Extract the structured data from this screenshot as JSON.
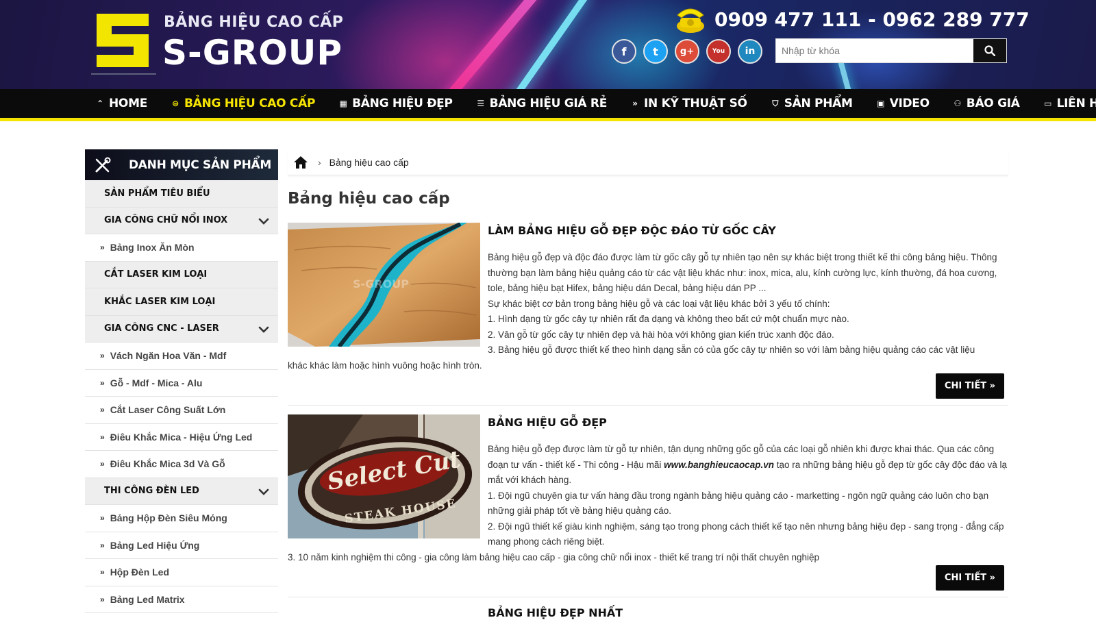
{
  "header": {
    "tagline": "BẢNG HIỆU CAO CẤP",
    "brand": "S-GROUP",
    "phone": "0909 477 111 - 0962 289 777",
    "socials": [
      {
        "name": "facebook",
        "glyph": "f"
      },
      {
        "name": "twitter",
        "glyph": "t"
      },
      {
        "name": "google-plus",
        "glyph": "g+"
      },
      {
        "name": "youtube",
        "glyph": "You"
      },
      {
        "name": "linkedin",
        "glyph": "in"
      }
    ],
    "search": {
      "placeholder": "Nhập từ khóa",
      "value": ""
    }
  },
  "nav": {
    "items": [
      {
        "label": "HOME",
        "icon": "chevron-up"
      },
      {
        "label": "BẢNG HIỆU CAO CẤP",
        "icon": "bars-circle",
        "active": true
      },
      {
        "label": "BẢNG HIỆU ĐẸP",
        "icon": "calendar"
      },
      {
        "label": "BẢNG HIỆU GIÁ RẺ",
        "icon": "list"
      },
      {
        "label": "IN KỸ THUẬT SỐ",
        "icon": "double-chevron-right"
      },
      {
        "label": "SẢN PHẨM",
        "icon": "shield"
      },
      {
        "label": "VIDEO",
        "icon": "youtube"
      },
      {
        "label": "BÁO GIÁ",
        "icon": "users"
      },
      {
        "label": "LIÊN HỆ",
        "icon": "money"
      }
    ]
  },
  "sidebar": {
    "title": "DANH MỤC SẢN PHẨM",
    "items": [
      {
        "label": "SẢN PHẨM TIÊU BIỂU",
        "type": "cat"
      },
      {
        "label": "GIA CÔNG CHỮ NỔI INOX",
        "type": "cat",
        "expandable": true
      },
      {
        "label": "Bảng Inox Ăn Mòn",
        "type": "sub"
      },
      {
        "label": "CẮT LASER KIM LOẠI",
        "type": "cat"
      },
      {
        "label": "KHẮC LASER KIM LOẠI",
        "type": "cat"
      },
      {
        "label": "GIA CÔNG CNC - LASER",
        "type": "cat",
        "expandable": true
      },
      {
        "label": "Vách Ngăn Hoa Văn - Mdf",
        "type": "sub"
      },
      {
        "label": "Gỗ - Mdf - Mica - Alu",
        "type": "sub"
      },
      {
        "label": "Cắt Laser Công Suất Lớn",
        "type": "sub"
      },
      {
        "label": "Điêu Khắc Mica - Hiệu Ứng Led",
        "type": "sub"
      },
      {
        "label": "Điêu Khắc Mica 3d Và Gỗ",
        "type": "sub"
      },
      {
        "label": "THI CÔNG ĐÈN LED",
        "type": "cat",
        "expandable": true
      },
      {
        "label": "Bảng Hộp Đèn Siêu Mỏng",
        "type": "sub"
      },
      {
        "label": "Bảng Led Hiệu Ứng",
        "type": "sub"
      },
      {
        "label": "Hộp Đèn Led",
        "type": "sub"
      },
      {
        "label": "Bảng Led Matrix",
        "type": "sub"
      }
    ]
  },
  "breadcrumb": {
    "current": "Bảng hiệu cao cấp"
  },
  "page_title": "Bảng hiệu cao cấp",
  "articles": [
    {
      "title": "LÀM BẢNG HIỆU GỖ ĐẸP ĐỘC ĐÁO TỪ GỐC CÂY",
      "image_watermark": "S-GROUP",
      "paragraphs": [
        "Bảng hiệu gỗ đẹp và độc đáo được làm từ gốc cây gỗ tự nhiên tạo nên sự khác biệt trong thiết kế thi công bảng hiệu. Thông thường bạn làm bảng hiệu quảng cáo từ các vật liệu khác như: inox, mica, alu, kính cường lực, kính thường, đá hoa cương, tole, bảng hiệu bạt Hifex, bảng hiệu dán Decal, bảng hiệu dán PP ...",
        "Sự khác biệt cơ bản trong bảng hiệu gỗ và các loại vật liệu khác bởi 3 yếu tố chính:",
        "1. Hình dạng từ gốc cây tự nhiên rất đa dạng và không theo bất cứ một chuẩn mực nào.",
        "2. Vân gỗ từ gốc cây tự nhiên đẹp và hài hòa với không gian kiến trúc xanh độc đáo.",
        "3. Bảng hiệu gỗ được thiết kế theo hình dạng sẵn có của gốc cây tự nhiên so với làm bảng hiệu quảng cáo các vật liệu",
        "khác khác làm hoặc hình vuông hoặc hình tròn."
      ],
      "button": "CHI TIẾT »"
    },
    {
      "title": "BẢNG HIỆU GỖ ĐẸP",
      "image_text_1": "Select Cut",
      "image_text_2": "STEAK HOUSE",
      "p1_before": "Bảng hiệu gỗ đẹp được làm từ gỗ tự nhiên, tận dụng những gốc gỗ của các loại gỗ nhiên khi được khai thác. Qua các công đoạn tư vấn - thiết kế - Thi công - Hậu mãi ",
      "p1_link": "www.banghieucaocap.vn",
      "p1_after": " tạo ra những bảng hiệu gỗ đẹp từ gốc cây độc đáo và lạ mắt với khách hàng.",
      "p2": "1. Đội ngũ chuyên gia tư vấn hàng đầu trong ngành bảng hiệu quảng cáo - marketting - ngôn ngữ quảng cáo luôn cho bạn những giải pháp tốt về bảng hiệu quảng cáo.",
      "p3": "2. Đội ngũ thiết kế giàu kinh nghiệm, sáng tạo trong phong cách thiết kế tạo nên nhưng bảng hiệu đẹp - sang trọng - đẳng cấp mang phong cách riêng biệt.",
      "p4": "3. 10 năm kinh nghiệm thi công - gia công làm bảng hiệu cao cấp - gia công chữ nổi inox - thiết kế trang trí nội thất chuyên nghiệp",
      "button": "CHI TIẾT »"
    },
    {
      "title": "BẢNG HIỆU ĐẸP NHẤT"
    }
  ],
  "colors": {
    "accent": "#f5e400",
    "nav_bg": "#0b0b0b",
    "button_bg": "#0a0a0a"
  }
}
